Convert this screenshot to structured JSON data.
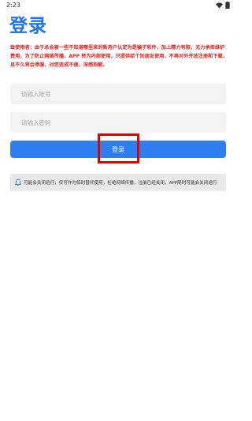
{
  "status_bar": {
    "time": "2:23",
    "icons": [
      "wifi-icon",
      "battery-icon"
    ]
  },
  "page": {
    "title": "登录",
    "notice": "致使用者：由于总会被一些不知道哪里来的新用户认定为是骗子软件，加上精力有限，无力承担维护费用，为了防止网络传播，APP 转为内部使用，只提供给个别朋友使用，不再对外开放注册和下载，且不久将会停服，对您造成不便，深感抱歉。"
  },
  "form": {
    "account_placeholder": "请输入账号",
    "account_value": "",
    "password_placeholder": "请输入密码",
    "password_value": "",
    "login_label": "登录"
  },
  "announcement": {
    "icon": "bell-icon",
    "text": "可能会关闭运行，仅可作为临时替代使用，杜绝网络传播，注册已经关闭，APP随时可能会关闭运行"
  },
  "colors": {
    "accent": "#1e73e8",
    "button": "#2d7ef0",
    "notice": "#e02020",
    "highlight": "#e00000"
  }
}
